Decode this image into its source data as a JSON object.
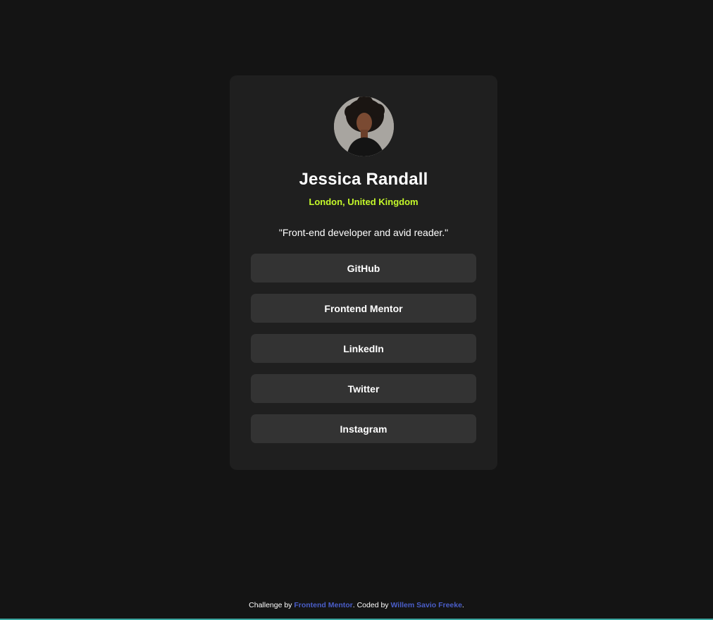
{
  "profile": {
    "name": "Jessica Randall",
    "location": "London, United Kingdom",
    "bio": "\"Front-end developer and avid reader.\""
  },
  "links": [
    {
      "label": "GitHub"
    },
    {
      "label": "Frontend Mentor"
    },
    {
      "label": "LinkedIn"
    },
    {
      "label": "Twitter"
    },
    {
      "label": "Instagram"
    }
  ],
  "attribution": {
    "prefix": "Challenge by ",
    "challenge_link": "Frontend Mentor",
    "middle": ". Coded by ",
    "author_link": "Willem Savio Freeke",
    "suffix": "."
  },
  "colors": {
    "background": "#141414",
    "card": "#1f1f1f",
    "button": "#333333",
    "accent_green": "#c4f82a",
    "link_blue": "#4a5ec9"
  }
}
